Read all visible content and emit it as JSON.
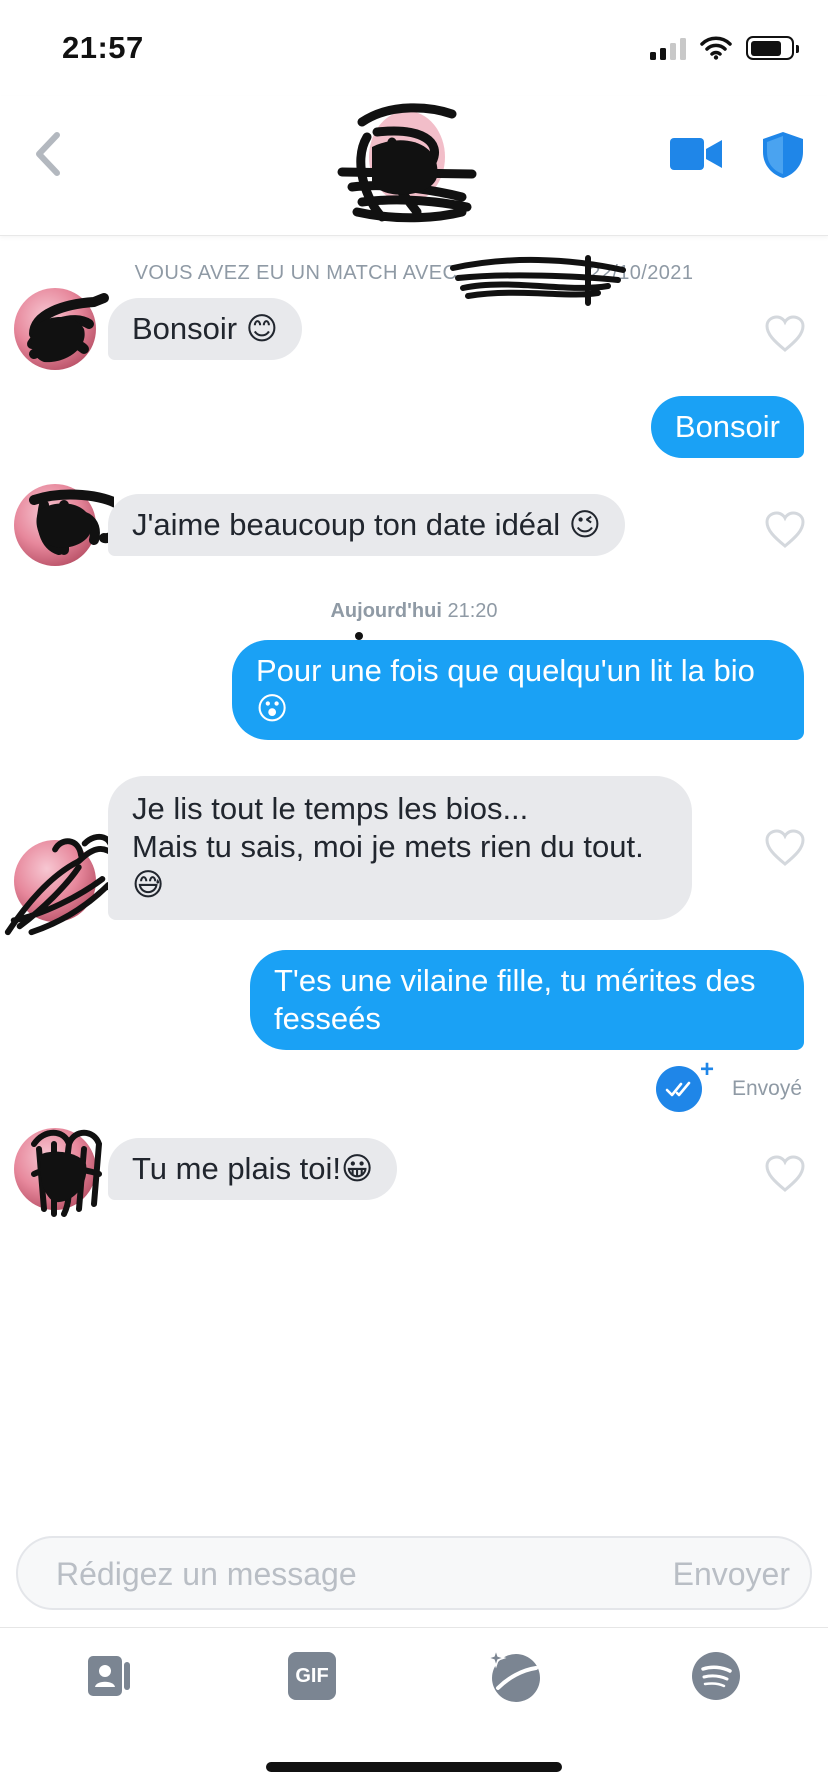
{
  "status_bar": {
    "time": "21:57"
  },
  "header": {
    "back": "back",
    "video_icon": "video-camera-icon",
    "shield_icon": "shield-icon"
  },
  "match": {
    "text": "VOUS AVEZ EU UN MATCH AVEC",
    "date": "22/10/2021"
  },
  "messages": [
    {
      "from": "them",
      "lines": [
        "Bonsoir 😊"
      ]
    },
    {
      "from": "me",
      "lines": [
        "Bonsoir"
      ]
    },
    {
      "from": "them",
      "lines": [
        "J'aime beaucoup ton date idéal 😉"
      ]
    },
    {
      "from": "me",
      "lines": [
        "Pour une fois que quelqu'un lit la bio",
        "😮"
      ]
    },
    {
      "from": "them",
      "lines": [
        "Je lis tout le temps les bios...",
        "Mais tu sais, moi je mets rien du tout.",
        "😅"
      ]
    },
    {
      "from": "me",
      "lines": [
        "T'es une vilaine fille, tu mérites des",
        "fesseés"
      ]
    },
    {
      "from": "them",
      "lines": [
        "Tu me plais toi!😀"
      ]
    }
  ],
  "timestamp": {
    "day": "Aujourd'hui",
    "time": "21:20"
  },
  "sent_status": {
    "label": "Envoyé",
    "plus": "+"
  },
  "composer": {
    "placeholder": "Rédigez un message",
    "send_label": "Envoyer"
  },
  "toolbar": {
    "gif_label": "GIF"
  },
  "colors": {
    "outgoing": "#1aa1f5",
    "incoming": "#e8e9ec",
    "accent": "#1f86e8"
  }
}
